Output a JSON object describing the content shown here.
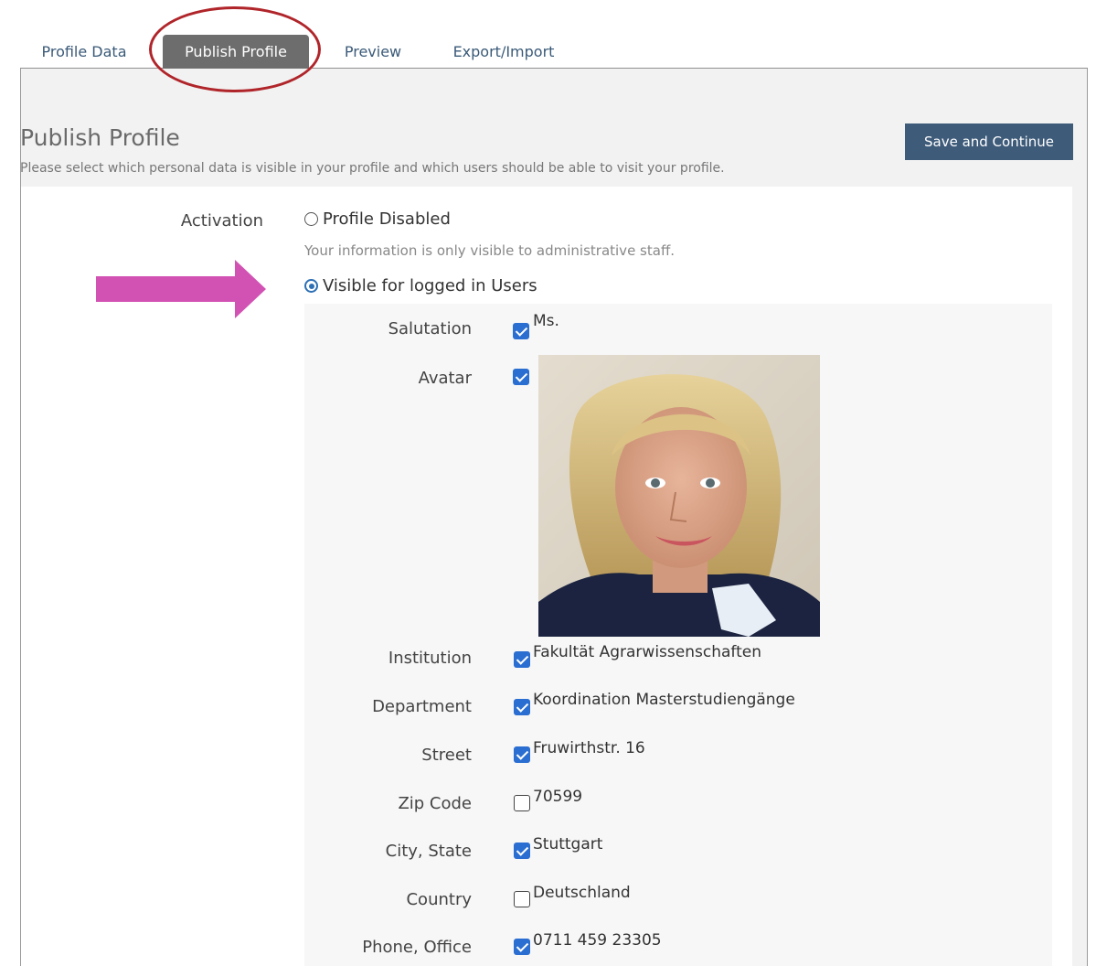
{
  "tabs": [
    {
      "label": "Profile Data",
      "active": false
    },
    {
      "label": "Publish Profile",
      "active": true
    },
    {
      "label": "Preview",
      "active": false
    },
    {
      "label": "Export/Import",
      "active": false
    }
  ],
  "header": {
    "title": "Publish Profile",
    "description": "Please select which personal data is visible in your profile and which users should be able to visit your profile.",
    "save_label": "Save and Continue"
  },
  "activation": {
    "label": "Activation",
    "options": [
      {
        "label": "Profile Disabled",
        "selected": false,
        "hint": "Your information is only visible to administrative staff."
      },
      {
        "label": "Visible for logged in Users",
        "selected": true
      }
    ]
  },
  "fields": [
    {
      "label": "Salutation",
      "value": "Ms.",
      "checked": true
    },
    {
      "label": "Avatar",
      "value": "",
      "checked": true
    },
    {
      "label": "Institution",
      "value": "Fakultät Agrarwissenschaften",
      "checked": true
    },
    {
      "label": "Department",
      "value": "Koordination Masterstudiengänge",
      "checked": true
    },
    {
      "label": "Street",
      "value": "Fruwirthstr. 16",
      "checked": true
    },
    {
      "label": "Zip Code",
      "value": "70599",
      "checked": false
    },
    {
      "label": "City, State",
      "value": "Stuttgart",
      "checked": true
    },
    {
      "label": "Country",
      "value": "Deutschland",
      "checked": false
    },
    {
      "label": "Phone, Office",
      "value": "0711 459 23305",
      "checked": true
    }
  ],
  "colors": {
    "accent": "#2a6ed1",
    "button": "#3e5b7a",
    "active_tab": "#6d6d6d",
    "highlight_circle": "#b0252a",
    "arrow": "#d252b4"
  }
}
